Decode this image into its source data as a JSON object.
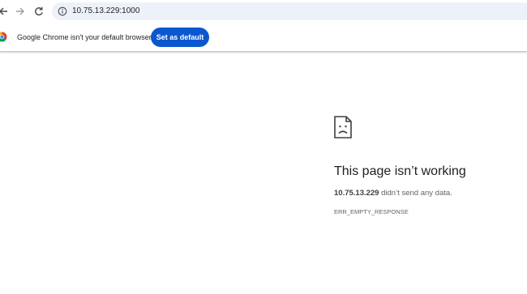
{
  "toolbar": {
    "url": "10.75.13.229:1000",
    "back_icon": "arrow-left-icon",
    "forward_icon": "arrow-right-icon",
    "reload_icon": "reload-icon",
    "site_info_icon": "info-icon"
  },
  "infobar": {
    "icon": "chrome-logo-icon",
    "message": "Google Chrome isn't your default browser",
    "button_label": "Set as default",
    "button_color": "#0b57d0"
  },
  "error_page": {
    "icon": "sad-document-icon",
    "title": "This page isn’t working",
    "host": "10.75.13.229",
    "detail_suffix": " didn’t send any data.",
    "error_code": "ERR_EMPTY_RESPONSE"
  }
}
